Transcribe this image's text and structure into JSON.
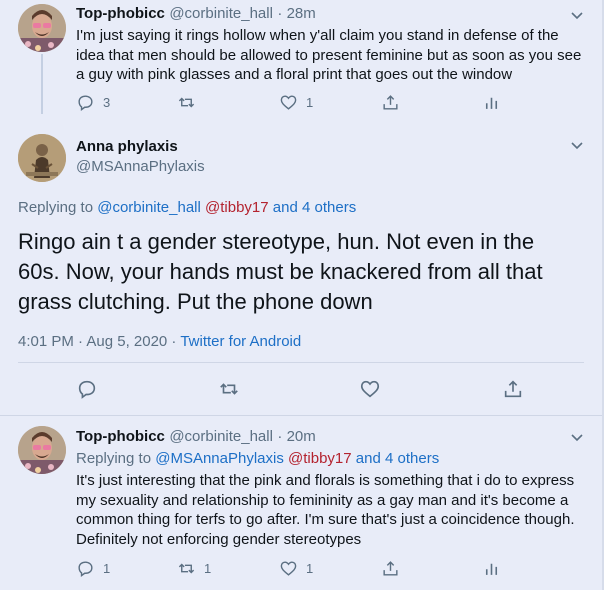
{
  "tweet1": {
    "name": "Top-phobicc",
    "handle": "@corbinite_hall",
    "time": "· 28m",
    "text": "I'm just saying it rings hollow when y'all claim you stand in defense of the idea that men should be allowed to present feminine but as soon as you see a guy with pink glasses and a floral print that goes out the window",
    "reply_count": "3",
    "retweet_count": "",
    "like_count": "1"
  },
  "main_tweet": {
    "name": "Anna phylaxis",
    "handle": "@MSAnnaPhylaxis",
    "replying_prefix": "Replying to",
    "mention1": "@corbinite_hall",
    "mention2": "@tibby17",
    "and_others": "and 4 others",
    "text": "Ringo ain t a gender stereotype, hun. Not even in the 60s. Now, your hands must be knackered from all that grass clutching. Put the phone down",
    "time": "4:01 PM · Aug 5, 2020 · ",
    "source": "Twitter for Android"
  },
  "tweet3": {
    "name": "Top-phobicc",
    "handle": "@corbinite_hall",
    "time": "· 20m",
    "replying_prefix": "Replying to",
    "mention1": "@MSAnnaPhylaxis",
    "mention2": "@tibby17",
    "and_others": "and 4 others",
    "text": "It's just interesting that the pink and florals is something that i do to express my sexuality and relationship to femininity as a gay man and it's become a common thing for terfs to go after. I'm sure that's just a coincidence though. Definitely not enforcing gender stereotypes",
    "reply_count": "1",
    "retweet_count": "1",
    "like_count": "1"
  },
  "colors": {
    "background": "#e8ecf8",
    "text": "#0f1419",
    "muted": "#5b6f82",
    "link": "#1d6fc6",
    "mention_red": "#b4232f"
  }
}
